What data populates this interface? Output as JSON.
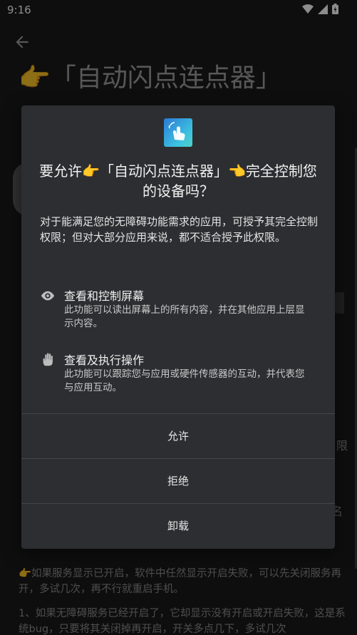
{
  "status_bar": {
    "time": "9:16",
    "icons": [
      "wifi-icon",
      "signal-icon",
      "battery-icon"
    ]
  },
  "background": {
    "title": "👉「自动闪点连点器」",
    "side_char_1": "限",
    "side_char_2": "名",
    "bottom_text_1": "👉如果服务显示已开启，软件中任然显示开启失败，可以先关闭服务再开，多试几次，再不行就重启手机。",
    "bottom_text_2": "1、如果无障碍服务已经开启了，它却显示没有开启或开启失败，这是系统bug，只要将其关闭掉再开启，开关多点几下，多试几次"
  },
  "dialog": {
    "title": "要允许👉「自动闪点连点器」👈完全控制您的设备吗？",
    "description": "对于能满足您的无障碍功能需求的应用，可授予其完全控制权限；但对大部分应用来说，都不适合授予此权限。",
    "permissions": [
      {
        "icon": "eye-icon",
        "title": "查看和控制屏幕",
        "desc": "此功能可以读出屏幕上的所有内容，并在其他应用上层显示内容。"
      },
      {
        "icon": "hand-icon",
        "title": "查看及执行操作",
        "desc": "此功能可以跟踪您与应用或硬件传感器的互动，并代表您与应用互动。"
      }
    ],
    "buttons": {
      "allow": "允许",
      "deny": "拒绝",
      "uninstall": "卸载"
    }
  },
  "colors": {
    "dialog_bg": "#2d2e31",
    "scrim": "rgba(0,0,0,0.45)",
    "text_primary": "#f1f1f1"
  }
}
